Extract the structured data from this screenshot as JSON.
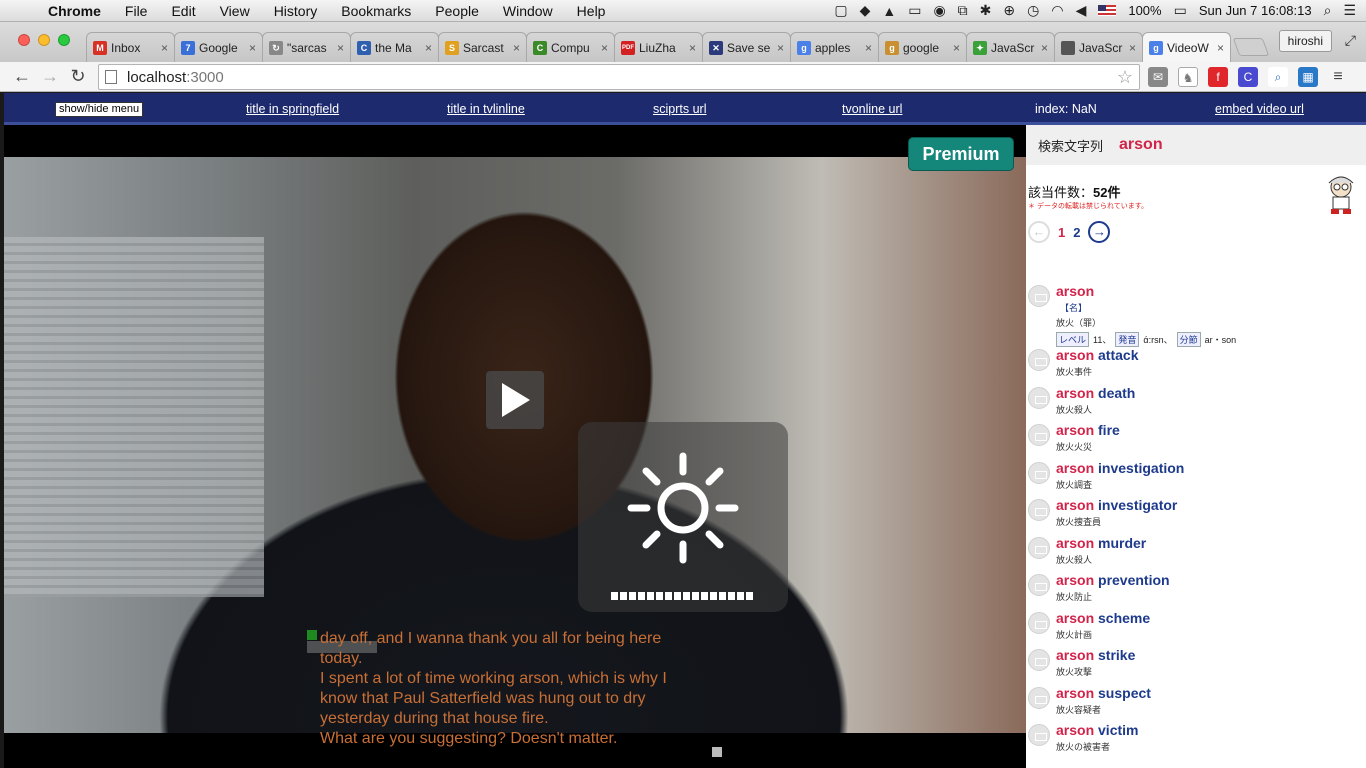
{
  "os_menu": {
    "app": "Chrome",
    "items": [
      "File",
      "Edit",
      "View",
      "History",
      "Bookmarks",
      "People",
      "Window",
      "Help"
    ],
    "battery": "100%",
    "datetime": "Sun Jun 7  16:08:13"
  },
  "tabs": [
    {
      "label": "Inbox",
      "icon": "gmail-icon",
      "color": "#d93025",
      "glyph": "M"
    },
    {
      "label": "Google",
      "icon": "google-calendar-icon",
      "color": "#3b6fd8",
      "glyph": "7"
    },
    {
      "label": "\"sarcas",
      "icon": "loading-icon",
      "color": "#888888",
      "glyph": "↻"
    },
    {
      "label": "the Ma",
      "icon": "site-icon",
      "color": "#2f5fb0",
      "glyph": "C"
    },
    {
      "label": "Sarcast",
      "icon": "site-icon",
      "color": "#e0a020",
      "glyph": "S"
    },
    {
      "label": "Compu",
      "icon": "site-icon",
      "color": "#3a8a2a",
      "glyph": "C"
    },
    {
      "label": "LiuZha",
      "icon": "pdf-icon",
      "color": "#d32020",
      "glyph": "PDF"
    },
    {
      "label": "Save se",
      "icon": "site-icon",
      "color": "#2a3a7a",
      "glyph": "✕"
    },
    {
      "label": "apples",
      "icon": "google-icon",
      "color": "#4a80e8",
      "glyph": "g"
    },
    {
      "label": "google",
      "icon": "site-icon",
      "color": "#c89030",
      "glyph": "g"
    },
    {
      "label": "JavaScr",
      "icon": "site-icon",
      "color": "#3aa03a",
      "glyph": "✦"
    },
    {
      "label": "JavaScr",
      "icon": "apple-icon",
      "color": "#555555",
      "glyph": ""
    },
    {
      "label": "VideoW",
      "icon": "google-icon",
      "color": "#4a80e8",
      "glyph": "g",
      "active": true
    }
  ],
  "profile": "hiroshi",
  "address": {
    "host": "localhost",
    "port": ":3000"
  },
  "sitenav": {
    "menu_button": "show/hide menu",
    "links": [
      "title in springfield",
      "title in tvlinline",
      "sciprts url",
      "tvonline url"
    ],
    "index_label": "index: NaN",
    "embed": "embed video url"
  },
  "video": {
    "premium": "Premium",
    "subtitle_lines": [
      "day off, and I wanna thank you all for being here",
      "today.",
      "I spent a lot of time working arson, which is why I",
      "know that Paul Satterfield was hung out to dry",
      "yesterday during that house fire.",
      "What are you suggesting? Doesn't matter."
    ],
    "brightness_level": 1.0
  },
  "dictionary": {
    "search_label": "検索文字列",
    "search_term": "arson",
    "count_label": "該当件数：",
    "count_value": "52件",
    "note": "＊ データの転載は禁じられています。",
    "pages": [
      "1",
      "2"
    ],
    "current_page": "1",
    "first_entry": {
      "word": "arson",
      "pos": "【名】",
      "gloss": "放火（罪）",
      "level_label": "レベル",
      "level": "11、",
      "pron_label": "発音",
      "pron": "ά:rsn、",
      "syll_label": "分節",
      "syll": "ar・son"
    },
    "entries": [
      {
        "hl": "arson",
        "rest": " attack",
        "gloss": "放火事件"
      },
      {
        "hl": "arson",
        "rest": " death",
        "gloss": "放火殺人"
      },
      {
        "hl": "arson",
        "rest": " fire",
        "gloss": "放火火災"
      },
      {
        "hl": "arson",
        "rest": " investigation",
        "gloss": "放火調査"
      },
      {
        "hl": "arson",
        "rest": " investigator",
        "gloss": "放火捜査員"
      },
      {
        "hl": "arson",
        "rest": " murder",
        "gloss": "放火殺人"
      },
      {
        "hl": "arson",
        "rest": " prevention",
        "gloss": "放火防止"
      },
      {
        "hl": "arson",
        "rest": " scheme",
        "gloss": "放火計画"
      },
      {
        "hl": "arson",
        "rest": " strike",
        "gloss": "放火攻撃"
      },
      {
        "hl": "arson",
        "rest": " suspect",
        "gloss": "放火容疑者"
      },
      {
        "hl": "arson",
        "rest": " victim",
        "gloss": "放火の被害者"
      }
    ]
  }
}
